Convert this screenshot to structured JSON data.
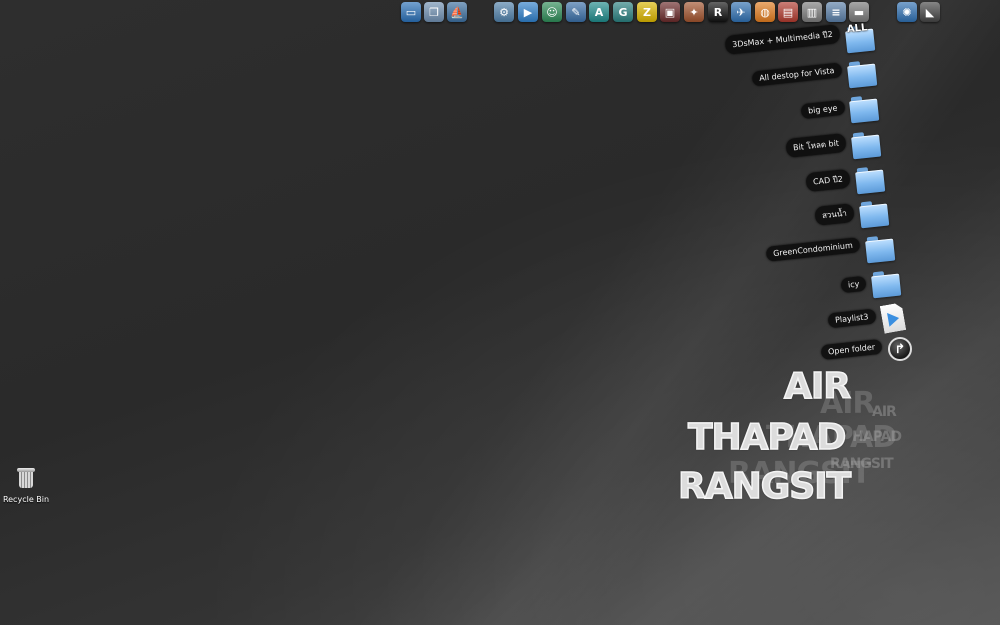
{
  "dock": {
    "icons": [
      {
        "name": "dock-icon-computer",
        "glyph": "▭",
        "color": "#2a6fb5"
      },
      {
        "name": "dock-icon-documents",
        "glyph": "❐",
        "color": "#6f8fb0"
      },
      {
        "name": "dock-icon-ship",
        "glyph": "⛵",
        "color": "#3c6e9e"
      },
      {
        "name": "dock-icon-system",
        "glyph": "⚙",
        "color": "#4f7fa8"
      },
      {
        "name": "dock-icon-media-player",
        "glyph": "▶",
        "color": "#2f7fc9"
      },
      {
        "name": "dock-icon-messenger",
        "glyph": "☺",
        "color": "#2e8b57"
      },
      {
        "name": "dock-icon-writer",
        "glyph": "✎",
        "color": "#3a6ea5"
      },
      {
        "name": "dock-icon-adobe-a",
        "glyph": "A",
        "color": "#1f8a8a"
      },
      {
        "name": "dock-icon-3dsmax",
        "glyph": "G",
        "color": "#2a7f7f"
      },
      {
        "name": "dock-icon-z",
        "glyph": "Z",
        "color": "#d9b400"
      },
      {
        "name": "dock-icon-monitor",
        "glyph": "▣",
        "color": "#6a2a2a"
      },
      {
        "name": "dock-icon-game",
        "glyph": "✦",
        "color": "#a0522d"
      },
      {
        "name": "dock-icon-rockstar",
        "glyph": "R",
        "color": "#111111"
      },
      {
        "name": "dock-icon-bird",
        "glyph": "✈",
        "color": "#2f6fb0"
      },
      {
        "name": "dock-icon-ball",
        "glyph": "◍",
        "color": "#e07b1f"
      },
      {
        "name": "dock-icon-video",
        "glyph": "▤",
        "color": "#b03a2e"
      },
      {
        "name": "dock-icon-clapper",
        "glyph": "▥",
        "color": "#7a7a7a"
      },
      {
        "name": "dock-icon-notepad",
        "glyph": "≡",
        "color": "#5a7ea6"
      },
      {
        "name": "dock-icon-drive",
        "glyph": "▬",
        "color": "#777777"
      },
      {
        "name": "dock-icon-network",
        "glyph": "✺",
        "color": "#2f6fb0"
      },
      {
        "name": "dock-icon-stack",
        "glyph": "◣",
        "color": "#444444"
      }
    ]
  },
  "stack": {
    "items": [
      {
        "label": "3DsMax + Multimedia ปี2",
        "type": "folder",
        "badge": "ALL"
      },
      {
        "label": "All destop for Vista",
        "type": "folder"
      },
      {
        "label": "big eye",
        "type": "folder"
      },
      {
        "label": "Bit โหลด bit",
        "type": "folder"
      },
      {
        "label": "CAD ปี2",
        "type": "folder"
      },
      {
        "label": "สวนน้ำ",
        "type": "folder"
      },
      {
        "label": "GreenCondominium",
        "type": "folder"
      },
      {
        "label": "icy",
        "type": "folder"
      },
      {
        "label": "Playlist3",
        "type": "playlist"
      },
      {
        "label": "Open folder",
        "type": "open"
      }
    ]
  },
  "wallpaper": {
    "line1": "AIR",
    "line2": "THAPAD",
    "line3": "RANGSIT",
    "echo_line1": "AIR",
    "echo_line2": "THAPAD",
    "echo_line3": "RANGSIT",
    "echo_small1": "AIR",
    "echo_small2": "HAPAD",
    "echo_small3": "RANGSIT"
  },
  "desktop": {
    "recycle_bin_label": "Recycle Bin"
  }
}
